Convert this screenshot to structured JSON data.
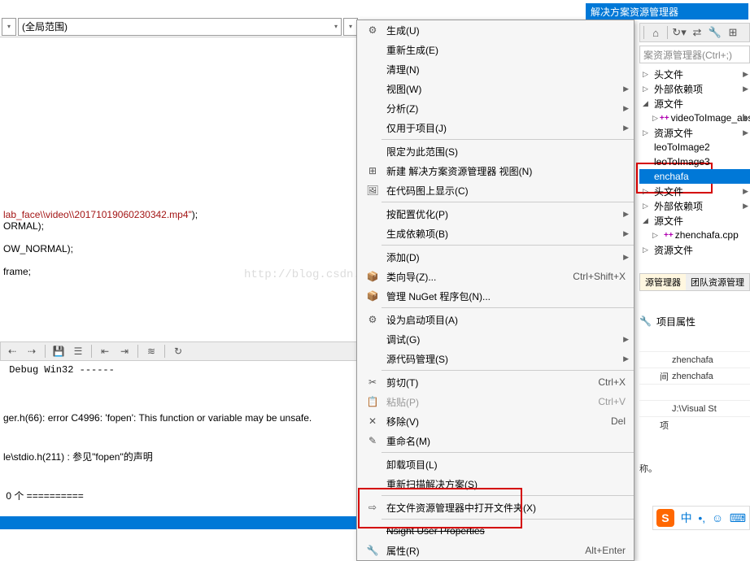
{
  "scope_dropdown": {
    "label": "(全局范围)"
  },
  "code": {
    "line1_prefix": "lab_face\\\\video\\\\20171019060230342.mp4\"",
    "line1_suffix": ");",
    "line2": "ORMAL);",
    "line3": "OW_NORMAL);",
    "line4": "frame;"
  },
  "watermark": "http://blog.csdn.net/Jkwwwwwwwwww",
  "debug_line": " Debug Win32 ------",
  "error_output": {
    "l1": "ger.h(66): error C4996: 'fopen': This function or variable may be unsafe.",
    "l2": "le\\stdio.h(211) : 参见\"fopen\"的声明",
    "l3": " 0 个 =========="
  },
  "context_menu": [
    {
      "icon": "gear",
      "label": "生成(U)",
      "shortcut": "",
      "sub": false
    },
    {
      "icon": "",
      "label": "重新生成(E)",
      "shortcut": "",
      "sub": false
    },
    {
      "icon": "",
      "label": "清理(N)",
      "shortcut": "",
      "sub": false
    },
    {
      "icon": "",
      "label": "视图(W)",
      "shortcut": "",
      "sub": true
    },
    {
      "icon": "",
      "label": "分析(Z)",
      "shortcut": "",
      "sub": true
    },
    {
      "icon": "",
      "label": "仅用于项目(J)",
      "shortcut": "",
      "sub": true
    },
    {
      "sep": true
    },
    {
      "icon": "",
      "label": "限定为此范围(S)",
      "shortcut": "",
      "sub": false
    },
    {
      "icon": "boxes",
      "label": "新建 解决方案资源管理器 视图(N)",
      "shortcut": "",
      "sub": false
    },
    {
      "icon": "img",
      "label": "在代码图上显示(C)",
      "shortcut": "",
      "sub": false
    },
    {
      "sep": true
    },
    {
      "icon": "",
      "label": "按配置优化(P)",
      "shortcut": "",
      "sub": true
    },
    {
      "icon": "",
      "label": "生成依赖项(B)",
      "shortcut": "",
      "sub": true
    },
    {
      "sep": true
    },
    {
      "icon": "",
      "label": "添加(D)",
      "shortcut": "",
      "sub": true
    },
    {
      "icon": "pkg",
      "label": "类向导(Z)...",
      "shortcut": "Ctrl+Shift+X",
      "sub": false
    },
    {
      "icon": "nuget",
      "label": "管理 NuGet 程序包(N)...",
      "shortcut": "",
      "sub": false
    },
    {
      "sep": true
    },
    {
      "icon": "star",
      "label": "设为启动项目(A)",
      "shortcut": "",
      "sub": false
    },
    {
      "icon": "",
      "label": "调试(G)",
      "shortcut": "",
      "sub": true
    },
    {
      "icon": "",
      "label": "源代码管理(S)",
      "shortcut": "",
      "sub": true
    },
    {
      "sep": true
    },
    {
      "icon": "cut",
      "label": "剪切(T)",
      "shortcut": "Ctrl+X",
      "sub": false
    },
    {
      "icon": "paste",
      "label": "粘贴(P)",
      "shortcut": "Ctrl+V",
      "sub": false,
      "disabled": true
    },
    {
      "icon": "del",
      "label": "移除(V)",
      "shortcut": "Del",
      "sub": false
    },
    {
      "icon": "rename",
      "label": "重命名(M)",
      "shortcut": "",
      "sub": false
    },
    {
      "sep": true
    },
    {
      "icon": "",
      "label": "卸载项目(L)",
      "shortcut": "",
      "sub": false
    },
    {
      "icon": "",
      "label": "重新扫描解决方案(S)",
      "shortcut": "",
      "sub": false
    },
    {
      "sep": true
    },
    {
      "icon": "open",
      "label": "在文件资源管理器中打开文件夹(X)",
      "shortcut": "",
      "sub": false
    },
    {
      "sep": true
    },
    {
      "icon": "",
      "label": "Nsight User Properties",
      "shortcut": "",
      "sub": false,
      "strike": true
    },
    {
      "icon": "wrench",
      "label": "属性(R)",
      "shortcut": "Alt+Enter",
      "sub": false
    }
  ],
  "solution_explorer": {
    "title": "解决方案资源管理器",
    "search_placeholder": "案资源管理器(Ctrl+;)",
    "tree": [
      {
        "expand": "▷",
        "label": "头文件"
      },
      {
        "expand": "▷",
        "label": "外部依赖项"
      },
      {
        "expand": "◢",
        "label": "源文件"
      },
      {
        "expand": "▷",
        "cpp": true,
        "label": "videoToImage_abs",
        "indent": 1
      },
      {
        "expand": "▷",
        "label": "资源文件"
      },
      {
        "expand": "",
        "label": "leoToImage2"
      },
      {
        "expand": "",
        "label": "leoToImage3"
      },
      {
        "expand": "",
        "label": "enchafa",
        "sel": true
      },
      {
        "expand": "▷",
        "label": "头文件"
      },
      {
        "expand": "▷",
        "label": "外部依赖项"
      },
      {
        "expand": "◢",
        "label": "源文件"
      },
      {
        "expand": "▷",
        "cpp": true,
        "label": "zhenchafa.cpp",
        "indent": 1
      },
      {
        "expand": "▷",
        "label": "资源文件"
      }
    ],
    "tabs": {
      "active": "源管理器",
      "other": "团队资源管理"
    }
  },
  "properties": {
    "header": "项目属性",
    "rows": [
      {
        "k": "",
        "v": "zhenchafa"
      },
      {
        "k": "间",
        "v": "zhenchafa"
      },
      {
        "k": "",
        "v": ""
      },
      {
        "k": "",
        "v": "J:\\Visual St"
      },
      {
        "k": "项",
        "v": ""
      }
    ],
    "desc": "称。"
  },
  "sogou": {
    "zh": "中"
  }
}
